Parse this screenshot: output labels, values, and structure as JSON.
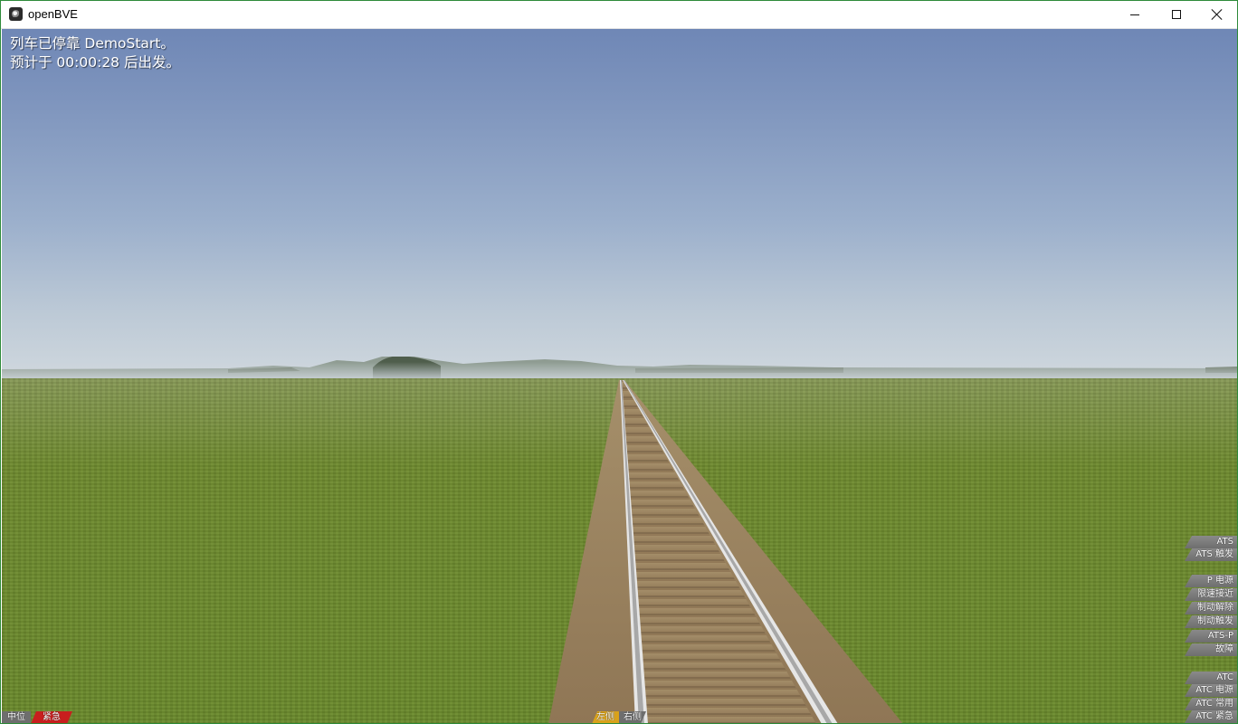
{
  "window": {
    "title": "openBVE",
    "icon": "openbve-app-icon",
    "controls": [
      "minimize-icon",
      "maximize-icon",
      "close-icon"
    ]
  },
  "message": {
    "line1": "列车已停靠 DemoStart。",
    "line2": "预计于 00:00:28 后出发。"
  },
  "indicators_right": {
    "ats": "ATS",
    "ats_trigger": "ATS 触发",
    "p_power": "P 电源",
    "pattern_approach": "限速接近",
    "brake_release": "制动解除",
    "brake_trigger": "制动触发",
    "ats_p": "ATS-P",
    "failure": "故障",
    "atc": "ATC",
    "atc_power": "ATC 电源",
    "atc_service": "ATC 常用",
    "atc_emergency": "ATC 紧急"
  },
  "indicators_bottom": {
    "reverser": "中位",
    "brake": "紧急",
    "door_left": "左侧",
    "door_right": "右侧"
  },
  "colors": {
    "window_border": "#2e8b3a",
    "sky_top": "#6f87b6",
    "sky_horizon": "#d0d8de",
    "grass": "#6a8a2c",
    "ballast": "#9a8463",
    "indicator_off": "#6e6e6e",
    "indicator_red": "#c81e1e",
    "indicator_amber": "#d9a21a"
  }
}
